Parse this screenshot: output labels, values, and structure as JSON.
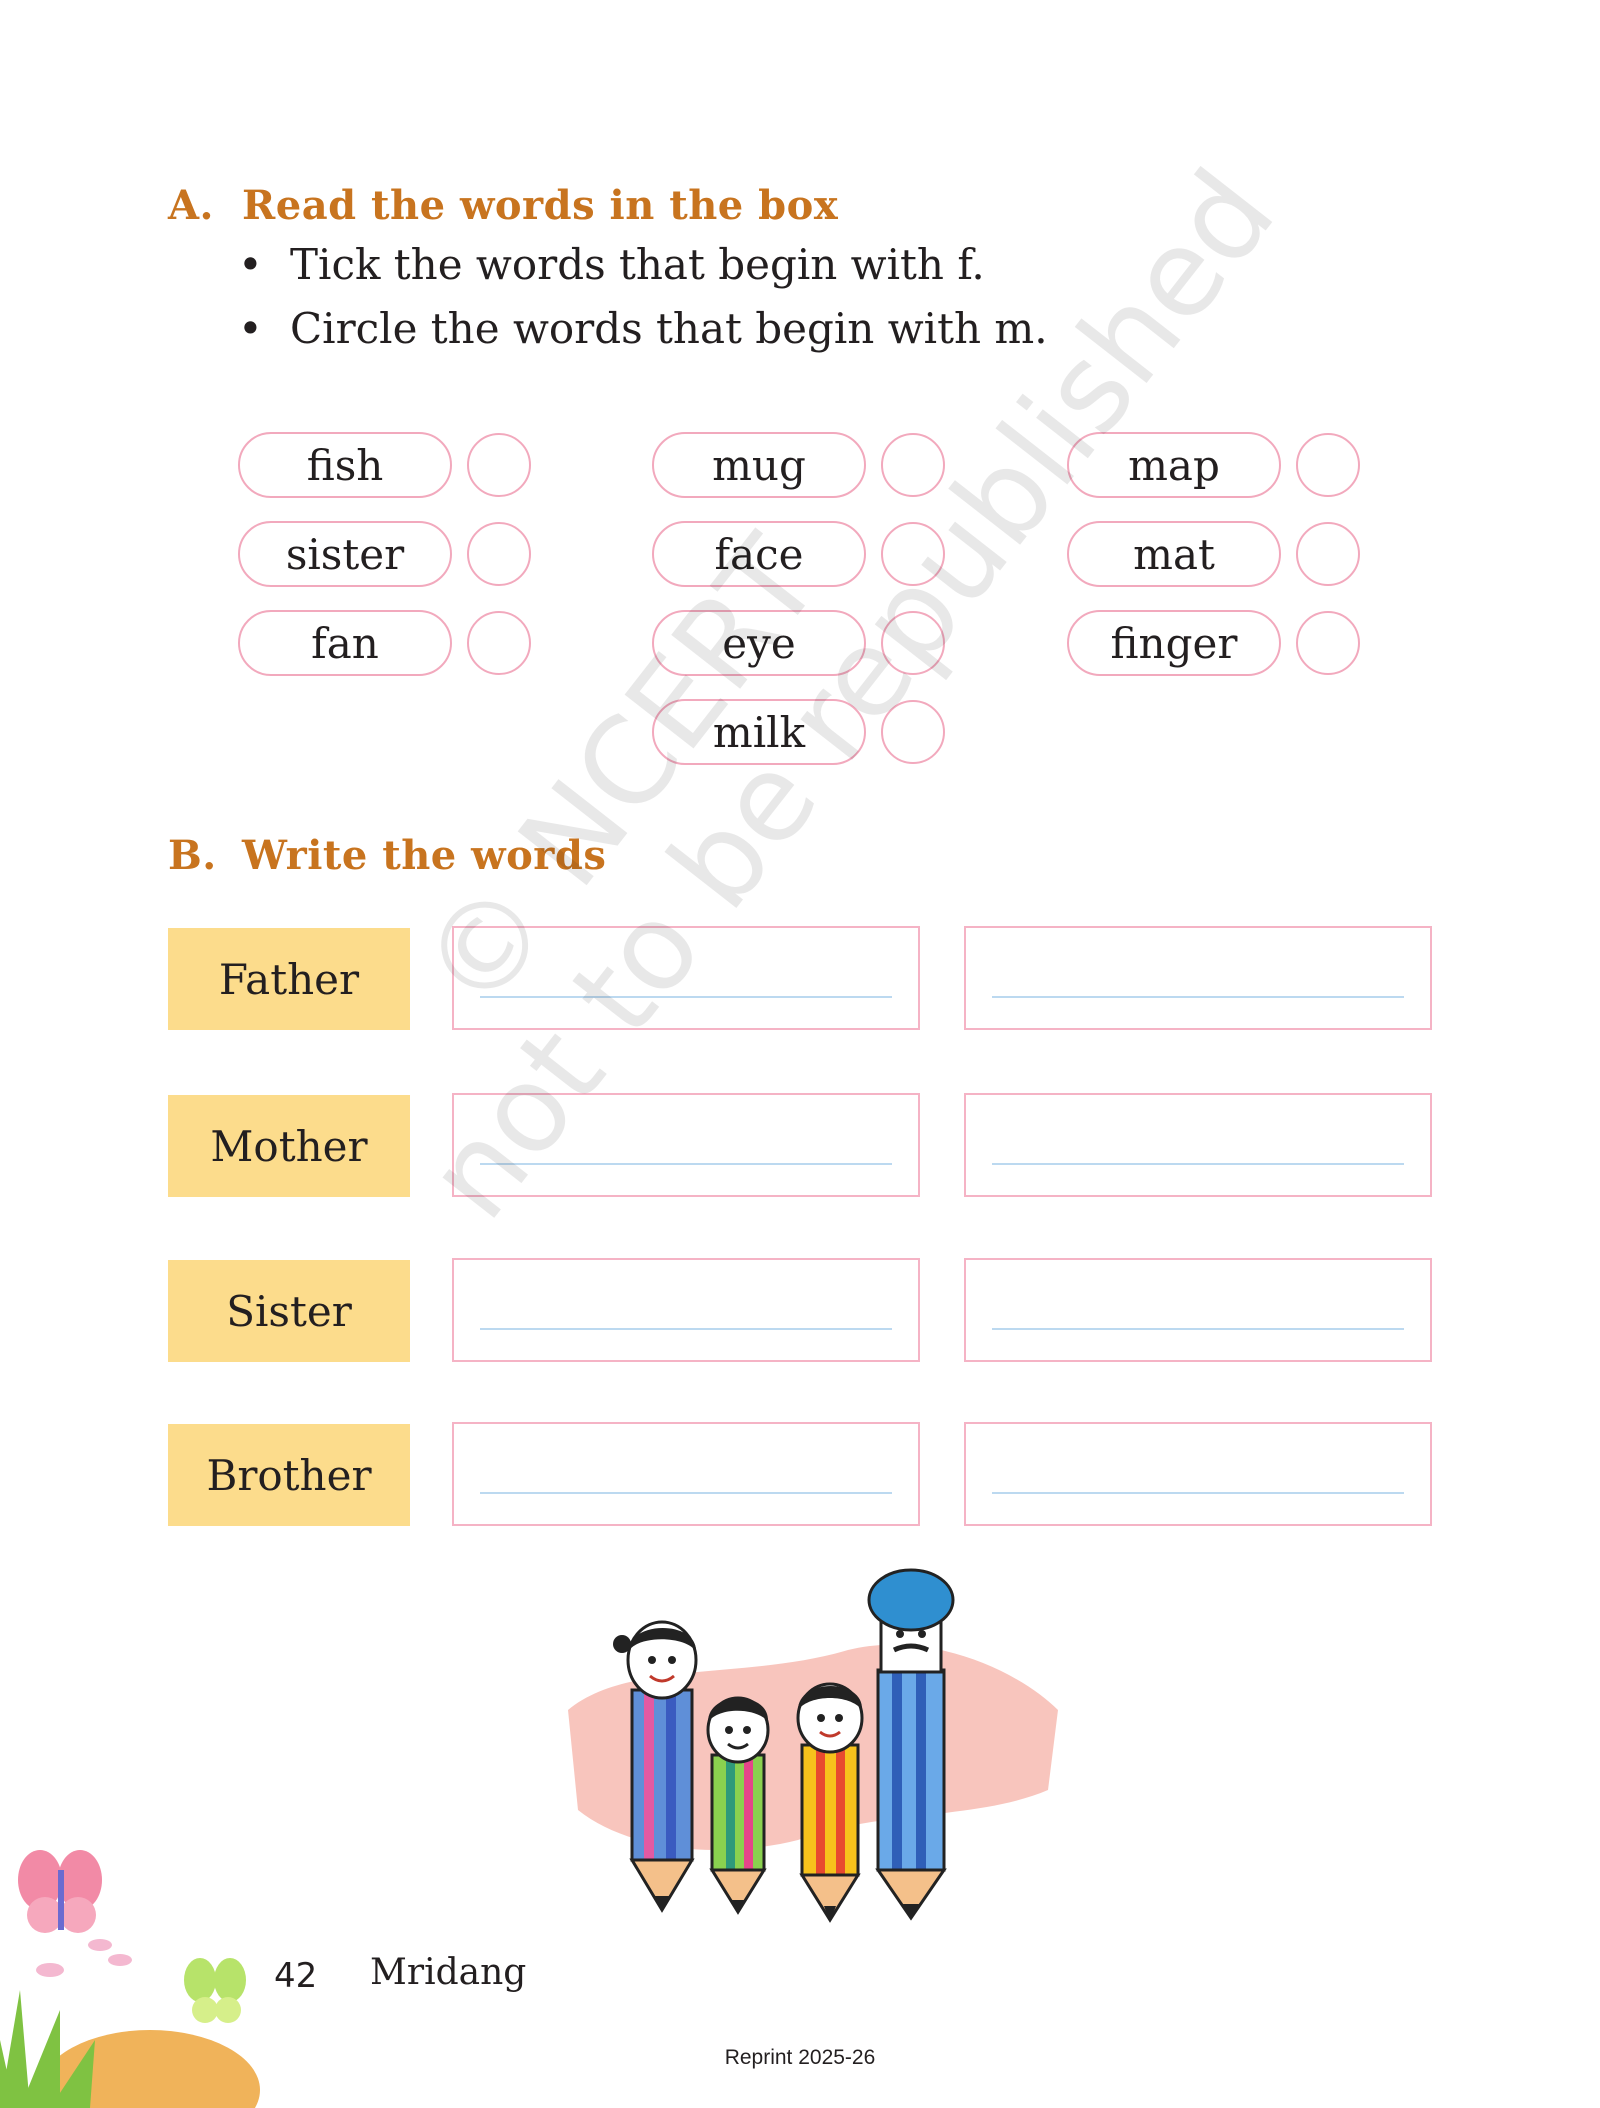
{
  "section_a": {
    "letter": "A.",
    "title": "Read the words in the box",
    "bullets": [
      "Tick the words that begin with f.",
      "Circle the words that begin with m."
    ],
    "columns": [
      [
        "fish",
        "sister",
        "fan"
      ],
      [
        "mug",
        "face",
        "eye",
        "milk"
      ],
      [
        "map",
        "mat",
        "finger"
      ]
    ]
  },
  "section_b": {
    "letter": "B.",
    "title": "Write the words",
    "rows": [
      "Father",
      "Mother",
      "Sister",
      "Brother"
    ]
  },
  "watermark": {
    "line1": "© NCERT",
    "line2": "not to be republished"
  },
  "footer": {
    "page_number": "42",
    "book_title": "Mridang",
    "reprint": "Reprint 2025-26"
  },
  "colors": {
    "heading": "#c8741f",
    "pill_border": "#f2a9bd",
    "label_fill": "#fcdc8c",
    "write_line": "#bcd9f0"
  }
}
